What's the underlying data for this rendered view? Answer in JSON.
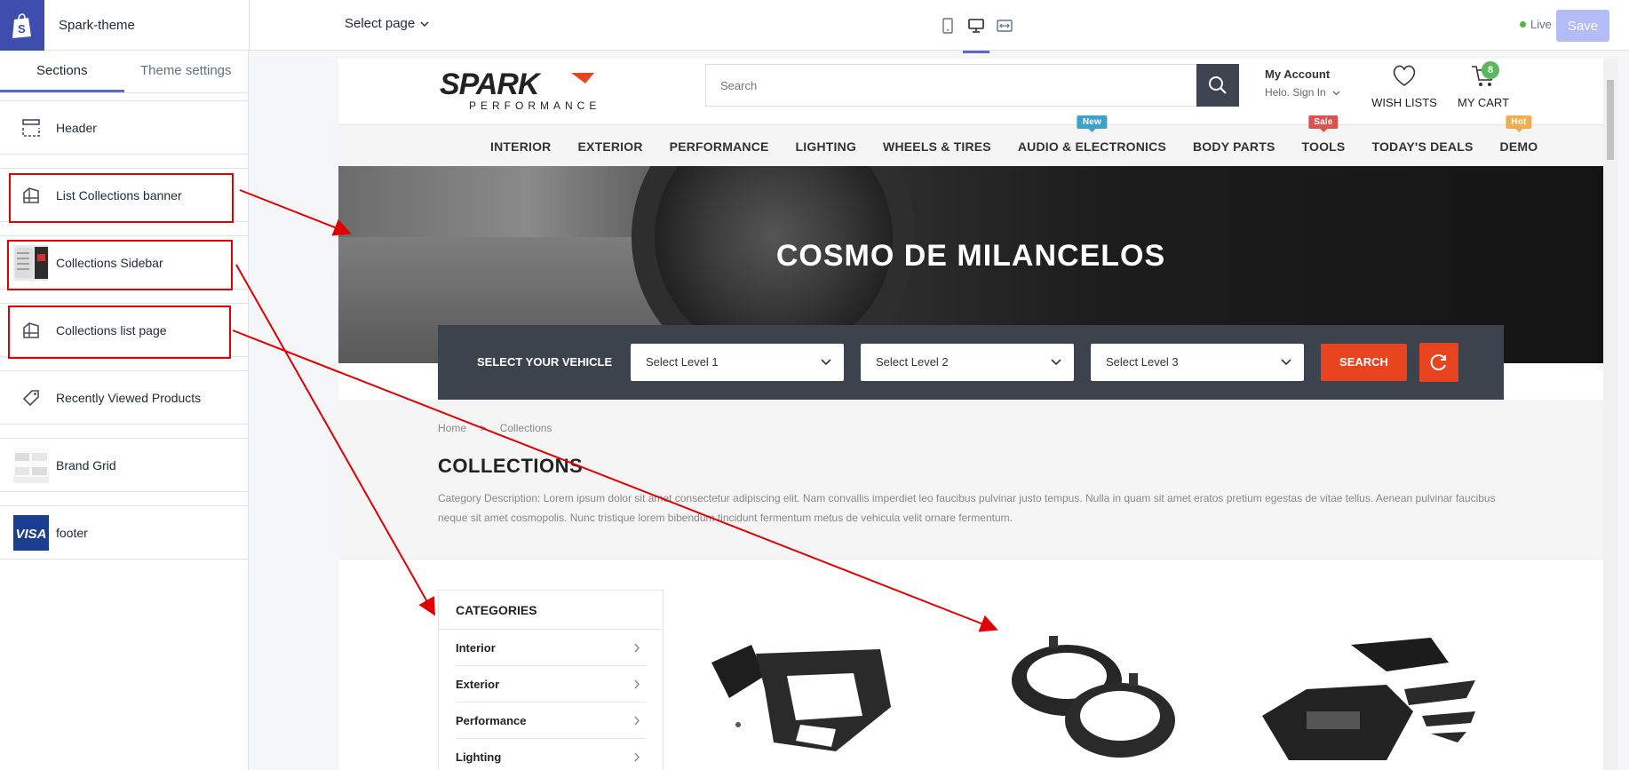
{
  "topbar": {
    "theme_name": "Spark-theme",
    "select_page": "Select page",
    "live_label": "Live",
    "save_label": "Save"
  },
  "sidebar": {
    "tabs": [
      {
        "label": "Sections",
        "active": true
      },
      {
        "label": "Theme settings",
        "active": false
      }
    ],
    "items": [
      {
        "label": "Header",
        "icon": "header-layout-icon"
      },
      {
        "label": "List Collections banner",
        "icon": "collection-icon"
      },
      {
        "label": "Collections Sidebar",
        "icon": "thumbnail-image"
      },
      {
        "label": "Collections list page",
        "icon": "collection-icon"
      },
      {
        "label": "Recently Viewed Products",
        "icon": "tag-icon"
      },
      {
        "label": "Brand Grid",
        "icon": "brand-grid-thumbnail"
      },
      {
        "label": "footer",
        "icon": "visa-thumbnail"
      }
    ]
  },
  "store": {
    "brand_name": "SPARK",
    "brand_sub": "PERFORMANCE",
    "search_placeholder": "Search",
    "account_title": "My Account",
    "account_sub": "Helo. Sign In",
    "wishlist_label": "WISH LISTS",
    "cart_label": "MY CART",
    "cart_count": "8",
    "nav": [
      {
        "label": "INTERIOR",
        "tag": "",
        "tag_color": ""
      },
      {
        "label": "EXTERIOR",
        "tag": "",
        "tag_color": ""
      },
      {
        "label": "PERFORMANCE",
        "tag": "",
        "tag_color": ""
      },
      {
        "label": "LIGHTING",
        "tag": "",
        "tag_color": ""
      },
      {
        "label": "WHEELS & TIRES",
        "tag": "",
        "tag_color": ""
      },
      {
        "label": "AUDIO & ELECTRONICS",
        "tag": "New",
        "tag_color": "#3ea2c8"
      },
      {
        "label": "BODY PARTS",
        "tag": "",
        "tag_color": ""
      },
      {
        "label": "TOOLS",
        "tag": "Sale",
        "tag_color": "#d9534f"
      },
      {
        "label": "TODAY'S DEALS",
        "tag": "",
        "tag_color": ""
      },
      {
        "label": "DEMO",
        "tag": "Hot",
        "tag_color": "#f0ad4e"
      }
    ],
    "banner_title": "COSMO DE MILANCELOS",
    "vehicle": {
      "label": "SELECT YOUR VEHICLE",
      "levels": [
        "Select Level 1",
        "Select Level 2",
        "Select Level 3"
      ],
      "search_label": "SEARCH"
    },
    "breadcrumb": [
      "Home",
      "Collections"
    ],
    "breadcrumb_sep": ">",
    "collections_title": "COLLECTIONS",
    "collections_desc": "Category Description: Lorem ipsum dolor sit amet consectetur adipiscing elit. Nam convallis imperdiet leo faucibus pulvinar justo tempus. Nulla in quam sit amet eratos pretium egestas de vitae tellus. Aenean pulvinar faucibus neque sit amet cosmopolis. Nunc tristique lorem bibendum tincidunt fermentum metus de vehicula velit ornare fermentum.",
    "categories_title": "CATEGORIES",
    "categories": [
      "Interior",
      "Exterior",
      "Performance",
      "Lighting"
    ]
  },
  "colors": {
    "admin_accent": "#5c6ac4",
    "annotation_red": "#e00000",
    "store_orange": "#e8441f",
    "vehicle_bar": "#3d434d",
    "live_green": "#50b83c"
  }
}
